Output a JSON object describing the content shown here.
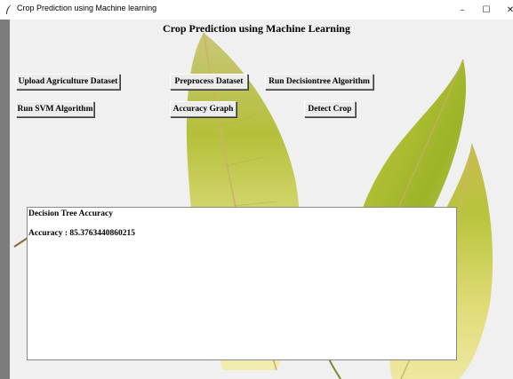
{
  "window": {
    "title": "Crop  Prediction using Machine learning",
    "controls": {
      "minimize": "–",
      "maximize": "☐",
      "close": "✕"
    }
  },
  "header": {
    "title": "Crop  Prediction using Machine Learning"
  },
  "buttons": {
    "upload": "Upload Agriculture Dataset",
    "preprocess": "Preprocess Dataset",
    "run_dt": "Run Decisiontree Algorithm",
    "run_svm": "Run SVM Algorithm",
    "accuracy_graph": "Accuracy Graph",
    "detect": "Detect Crop"
  },
  "output": {
    "line1": "Decision  Tree Accuracy",
    "line2": "Accuracy : 85.3763440860215"
  },
  "colors": {
    "leaf_light": "#e6e08a",
    "leaf_green": "#a8b828",
    "leaf_vein": "#b8a860",
    "background": "#f0f0f0"
  }
}
